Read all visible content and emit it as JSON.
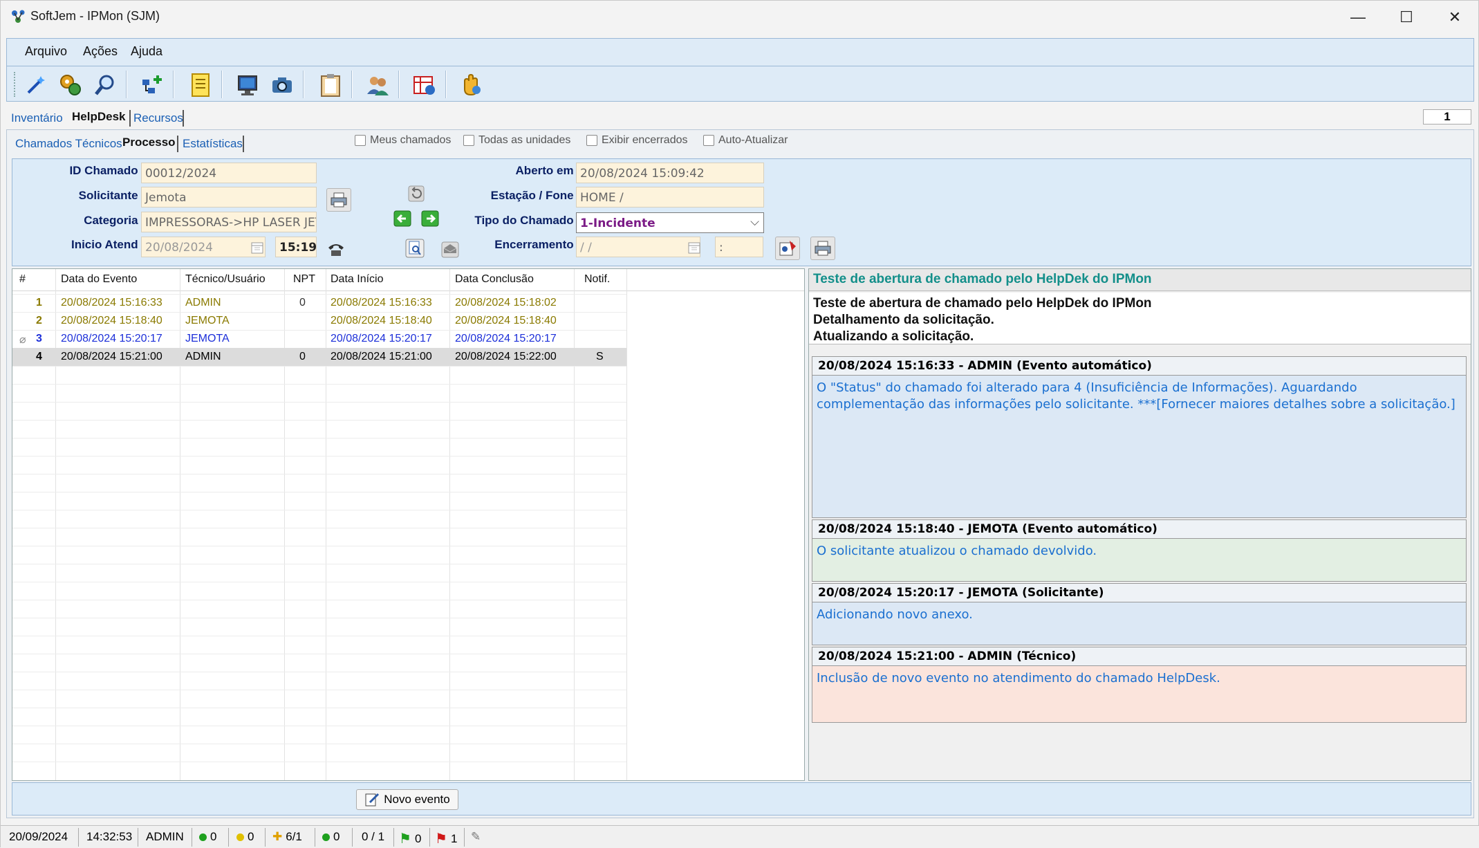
{
  "window": {
    "title": "SoftJem - IPMon (SJM)"
  },
  "menu": [
    "Arquivo",
    "Ações",
    "Ajuda"
  ],
  "tabs_main": [
    "Inventário",
    "HelpDesk",
    "Recursos"
  ],
  "page_counter": "1",
  "tabs_sub": [
    "Chamados Técnicos",
    "Processo",
    "Estatísticas"
  ],
  "filters": [
    "Meus chamados",
    "Todas as unidades",
    "Exibir encerrados",
    "Auto-Atualizar"
  ],
  "form": {
    "id_label": "ID Chamado :",
    "id_value": "00012/2024",
    "solicitante_label": "Solicitante :",
    "solicitante_value": "Jemota",
    "categoria_label": "Categoria :",
    "categoria_value": "IMPRESSORAS->HP LASER JET",
    "inicio_label": "Inicio Atend :",
    "inicio_date": "20/08/2024",
    "inicio_time": "15:19",
    "aberto_label": "Aberto em :",
    "aberto_value": "20/08/2024 15:09:42",
    "estacao_label": "Estação / Fone :",
    "estacao_value": "HOME /",
    "tipo_label": "Tipo do Chamado :",
    "tipo_value": "1-Incidente",
    "encerramento_label": "Encerramento :",
    "encerramento_date": " /  /",
    "encerramento_time": ":"
  },
  "grid": {
    "columns": [
      "#",
      "Data do Evento",
      "Técnico/Usuário",
      "NPT",
      "Data Início",
      "Data Conclusão",
      "Notif."
    ],
    "rows": [
      {
        "n": "1",
        "evento": "20/08/2024 15:16:33",
        "tecnico": "ADMIN",
        "npt": "0",
        "inicio": "20/08/2024 15:16:33",
        "conclusao": "20/08/2024 15:18:02",
        "notif": ""
      },
      {
        "n": "2",
        "evento": "20/08/2024 15:18:40",
        "tecnico": "JEMOTA",
        "npt": "",
        "inicio": "20/08/2024 15:18:40",
        "conclusao": "20/08/2024 15:18:40",
        "notif": ""
      },
      {
        "n": "3",
        "evento": "20/08/2024 15:20:17",
        "tecnico": "JEMOTA",
        "npt": "",
        "inicio": "20/08/2024 15:20:17",
        "conclusao": "20/08/2024 15:20:17",
        "notif": ""
      },
      {
        "n": "4",
        "evento": "20/08/2024 15:21:00",
        "tecnico": "ADMIN",
        "npt": "0",
        "inicio": "20/08/2024 15:21:00",
        "conclusao": "20/08/2024 15:22:00",
        "notif": "S"
      }
    ]
  },
  "detail": {
    "title": "Teste de abertura de chamado pelo HelpDek do IPMon",
    "desc_line1": "Teste de abertura de chamado pelo HelpDek do IPMon",
    "desc_line2": "Detalhamento da solicitação.",
    "desc_line3": "Atualizando a solicitação.",
    "events": [
      {
        "header": "20/08/2024 15:16:33  -  ADMIN  (Evento automático)",
        "body": "O \"Status\" do chamado foi alterado para 4 (Insuficiência de Informações). Aguardando complementação das informações pelo solicitante. ***[Fornecer maiores detalhes sobre a solicitação.]",
        "bg": "#dce8f5"
      },
      {
        "header": "20/08/2024 15:18:40  -  JEMOTA  (Evento automático)",
        "body": "O solicitante atualizou o chamado devolvido.",
        "bg": "#e3efe3"
      },
      {
        "header": "20/08/2024 15:20:17  -  JEMOTA  (Solicitante)",
        "body": "Adicionando novo anexo.",
        "bg": "#dce8f5"
      },
      {
        "header": "20/08/2024 15:21:00  -  ADMIN  (Técnico)",
        "body": "Inclusão de novo evento no atendimento do chamado HelpDesk.",
        "bg": "#fbe4dc"
      }
    ]
  },
  "novo_evento": "Novo evento",
  "status": {
    "date": "20/09/2024",
    "time": "14:32:53",
    "user": "ADMIN",
    "green1": "0",
    "yellow": "0",
    "plus": "6/1",
    "green2": "0",
    "ratio": "0 / 1",
    "flag_green": "0",
    "flag_red": "1"
  }
}
